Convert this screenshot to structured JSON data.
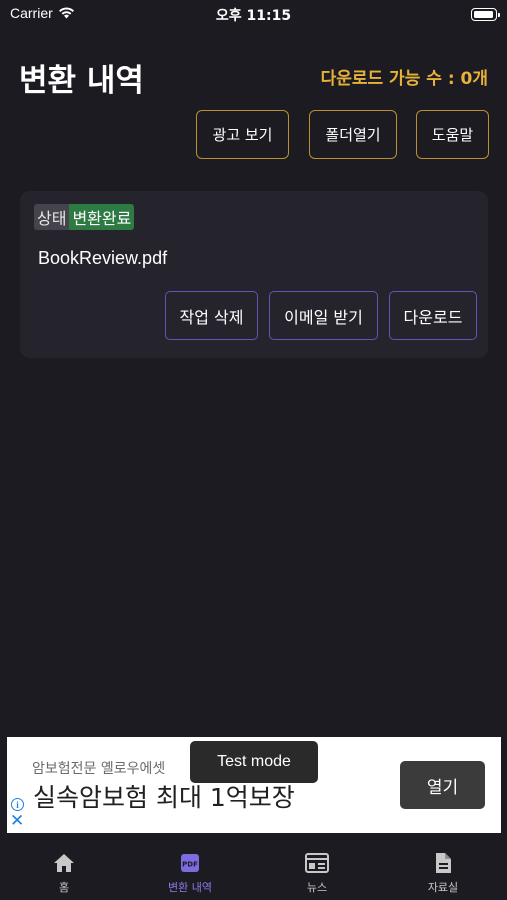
{
  "status_bar": {
    "carrier": "Carrier",
    "time": "오후 11:15"
  },
  "header": {
    "title": "변환 내역",
    "download_count": "다운로드 가능 수 :  0개"
  },
  "toolbar": {
    "ad_view": "광고 보기",
    "open_folder": "폴더열기",
    "help": "도움말"
  },
  "job": {
    "status_label": "상태",
    "status_value": "변환완료",
    "file_name": "BookReview.pdf",
    "delete": "작업 삭제",
    "email": "이메일 받기",
    "download": "다운로드"
  },
  "ad": {
    "sub": "암보험전문 옐로우에셋",
    "headline": "실속암보험 최대 1억보장",
    "test_mode": "Test mode",
    "open": "열기",
    "info": "i",
    "close": "✕"
  },
  "tabs": [
    {
      "label": "홈",
      "icon": "home-icon"
    },
    {
      "label": "변환 내역",
      "icon": "pdf-icon"
    },
    {
      "label": "뉴스",
      "icon": "newspaper-icon"
    },
    {
      "label": "자료실",
      "icon": "document-icon"
    }
  ],
  "colors": {
    "accent": "#e8b23a",
    "button_border": "#b8902f",
    "action_border": "#6253b7",
    "status_green": "#2d7a43",
    "active_tab": "#8a7ce8"
  }
}
